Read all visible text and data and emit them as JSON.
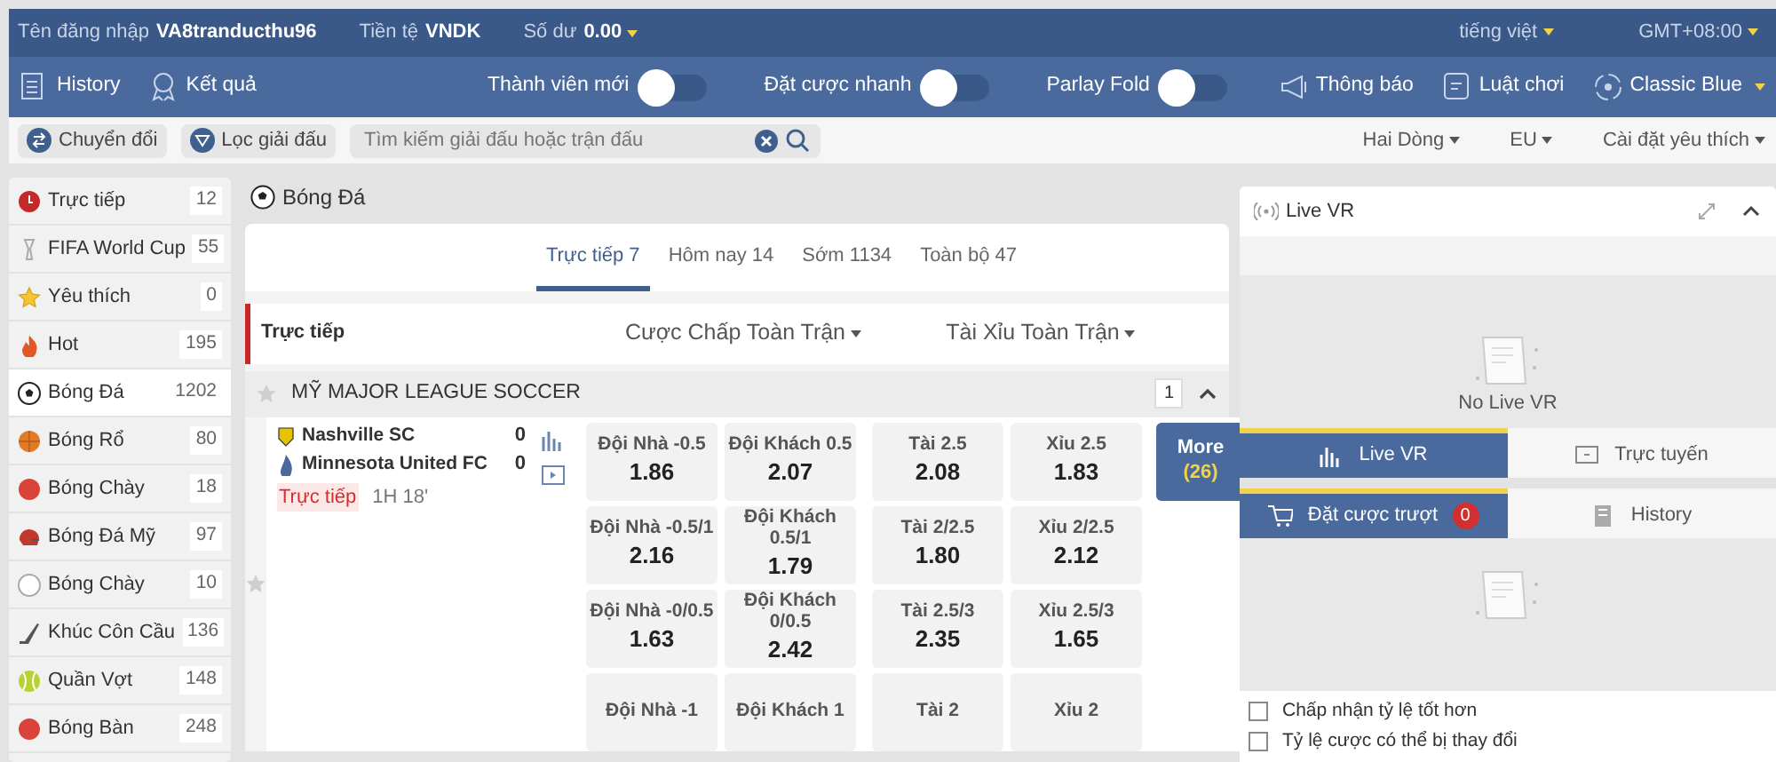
{
  "top_bar": {
    "username_label": "Tên đăng nhập",
    "username": "VA8tranducthu96",
    "currency_label": "Tiền tệ",
    "currency": "VNDK",
    "balance_label": "Số dư",
    "balance": "0.00",
    "language": "tiếng việt",
    "timezone": "GMT+08:00"
  },
  "toolbar": {
    "links": [
      {
        "label": "History",
        "kind": "list"
      },
      {
        "label": "Kết quả",
        "kind": "award"
      }
    ],
    "toggles": [
      {
        "label": "Thành viên mới",
        "on": false
      },
      {
        "label": "Đặt cược nhanh",
        "on": false
      },
      {
        "label": "Parlay Fold",
        "on": false
      }
    ],
    "right": [
      {
        "label": "Thông báo",
        "kind": "megaphone",
        "dropdown": false
      },
      {
        "label": "Luật chơi",
        "kind": "doc",
        "dropdown": false
      },
      {
        "label": "Classic Blue",
        "kind": "theme",
        "dropdown": true
      }
    ]
  },
  "filter_bar": {
    "buttons": [
      {
        "label": "Chuyển đổi",
        "kind": "switch"
      },
      {
        "label": "Lọc giải đấu",
        "kind": "filter"
      }
    ],
    "search": {
      "placeholder": "Tìm kiếm giải đấu hoặc trận đấu"
    },
    "dropdowns": [
      "Hai Dòng",
      "EU",
      "Cài đặt yêu thích"
    ]
  },
  "sidebar": {
    "items": [
      {
        "label": "Trực tiếp",
        "count": "12",
        "selected": false
      },
      {
        "label": "FIFA World Cup",
        "count": "55",
        "selected": false
      },
      {
        "label": "Yêu thích",
        "count": "0",
        "selected": false
      },
      {
        "label": "Hot",
        "count": "195",
        "selected": false
      },
      {
        "label": "Bóng Đá",
        "count": "1202",
        "selected": true
      },
      {
        "label": "Bóng Rổ",
        "count": "80",
        "selected": false
      },
      {
        "label": "Bóng Chày",
        "count": "18",
        "selected": false
      },
      {
        "label": "Bóng Đá Mỹ",
        "count": "97",
        "selected": false
      },
      {
        "label": "Bóng Chày",
        "count": "10",
        "selected": false
      },
      {
        "label": "Khúc Côn Cầu",
        "count": "136",
        "selected": false
      },
      {
        "label": "Quần Vợt",
        "count": "148",
        "selected": false
      },
      {
        "label": "Bóng Bàn",
        "count": "248",
        "selected": false
      }
    ]
  },
  "main": {
    "title": "Bóng Đá",
    "tabs": [
      {
        "label": "Trực tiếp 7",
        "selected": true
      },
      {
        "label": "Hôm nay 14",
        "selected": false
      },
      {
        "label": "Sớm 1134",
        "selected": false
      },
      {
        "label": "Toàn bộ 47",
        "selected": false
      }
    ],
    "header": {
      "label": "Trực tiếp",
      "markets": [
        "Cược Chấp Toàn Trận",
        "Tài Xỉu Toàn Trận"
      ]
    },
    "league": {
      "name": "MỸ MAJOR LEAGUE SOCCER",
      "count": "1",
      "favorite": false,
      "expanded": true
    },
    "match": {
      "favorite": false,
      "home": {
        "name": "Nashville SC",
        "score": "0"
      },
      "away": {
        "name": "Minnesota United FC",
        "score": "0"
      },
      "status": "Trực tiếp",
      "time": "1H 18'",
      "more_label": "More",
      "more_count": "(26)",
      "odds": [
        [
          {
            "label": "Đội Nhà -0.5",
            "price": "1.86"
          },
          {
            "label": "Đội Khách 0.5",
            "price": "2.07"
          },
          {
            "label": "Tài 2.5",
            "price": "2.08"
          },
          {
            "label": "Xỉu 2.5",
            "price": "1.83"
          }
        ],
        [
          {
            "label": "Đội Nhà -0.5/1",
            "price": "2.16"
          },
          {
            "label": "Đội Khách 0.5/1",
            "price": "1.79"
          },
          {
            "label": "Tài 2/2.5",
            "price": "1.80"
          },
          {
            "label": "Xỉu 2/2.5",
            "price": "2.12"
          }
        ],
        [
          {
            "label": "Đội Nhà -0/0.5",
            "price": "1.63"
          },
          {
            "label": "Đội Khách 0/0.5",
            "price": "2.42"
          },
          {
            "label": "Tài 2.5/3",
            "price": "2.35"
          },
          {
            "label": "Xỉu 2.5/3",
            "price": "1.65"
          }
        ],
        [
          {
            "label": "Đội Nhà -1"
          },
          {
            "label": "Đội Khách 1"
          },
          {
            "label": "Tài 2"
          },
          {
            "label": "Xỉu 2"
          }
        ]
      ]
    }
  },
  "right_panel": {
    "title": "Live VR",
    "empty_text": "No Live VR",
    "tabs": [
      {
        "label": "Live VR",
        "selected": true,
        "kind": "bars"
      },
      {
        "label": "Trực tuyến",
        "selected": false,
        "kind": "screen"
      }
    ],
    "bet_tabs": [
      {
        "label": "Đặt cược trượt",
        "badge": "0",
        "selected": true,
        "kind": "cart"
      },
      {
        "label": "History",
        "selected": false,
        "kind": "book"
      }
    ],
    "options": [
      {
        "label": "Chấp nhận tỷ lệ tốt hơn",
        "checked": false
      },
      {
        "label": "Tỷ lệ cược có thể bị thay đổi",
        "checked": false
      }
    ]
  }
}
